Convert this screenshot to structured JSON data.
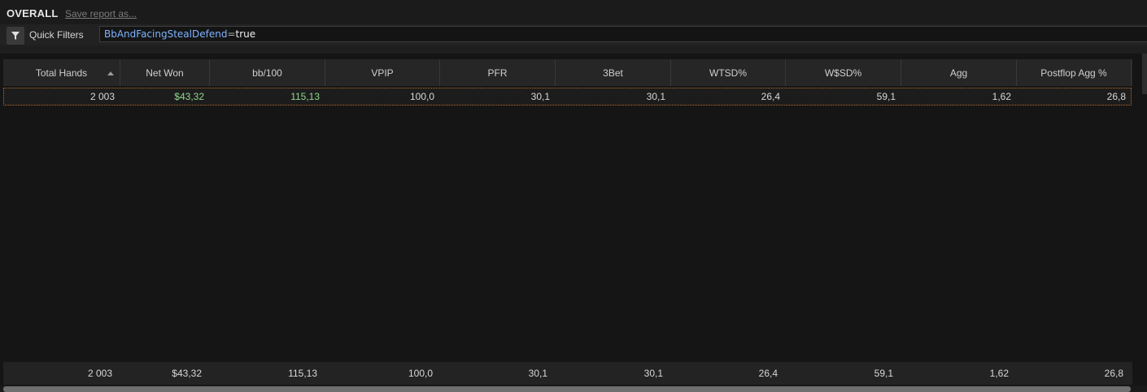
{
  "header": {
    "title": "OVERALL",
    "save_link": "Save report as..."
  },
  "filter": {
    "label": "Quick Filters",
    "icon": "funnel-icon",
    "key": "BbAndFacingStealDefend",
    "op": "=",
    "value": "true"
  },
  "columns": [
    "Total Hands",
    "Net Won",
    "bb/100",
    "VPIP",
    "PFR",
    "3Bet",
    "WTSD%",
    "W$SD%",
    "Agg",
    "Postflop Agg %"
  ],
  "sort": {
    "column": "Total Hands",
    "direction": "ascending"
  },
  "rows": [
    [
      "2 003",
      "$43,32",
      "115,13",
      "100,0",
      "30,1",
      "30,1",
      "26,4",
      "59,1",
      "1,62",
      "26,8"
    ]
  ],
  "totals": [
    "2 003",
    "$43,32",
    "115,13",
    "100,0",
    "30,1",
    "30,1",
    "26,4",
    "59,1",
    "1,62",
    "26,8"
  ],
  "colors": {
    "positive": "#8fd88a",
    "selected_row_border": "#b86d28",
    "filter_key": "#7fb3ff"
  }
}
